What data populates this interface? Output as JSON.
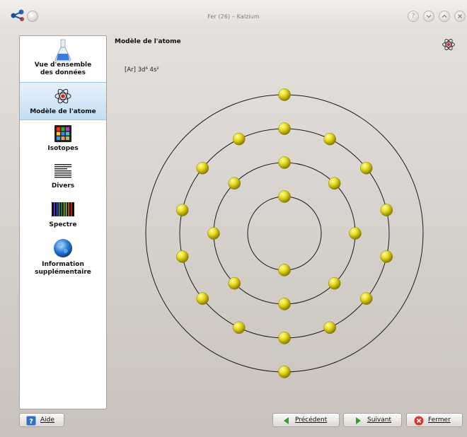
{
  "window": {
    "title": "Fer (26) – Kalzium"
  },
  "sidebar": {
    "items": [
      {
        "label": "Vue d'ensemble des données",
        "line1": "Vue d'ensemble",
        "line2": "des données",
        "icon": "flask-icon"
      },
      {
        "label": "Modèle de l'atome",
        "icon": "atom-icon",
        "selected": true
      },
      {
        "label": "Isotopes",
        "icon": "isotopes-grid-icon"
      },
      {
        "label": "Divers",
        "icon": "misc-lines-icon"
      },
      {
        "label": "Spectre",
        "icon": "spectrum-icon"
      },
      {
        "label": "Information supplémentaire",
        "line1": "Information",
        "line2": "supplémentaire",
        "icon": "globe-icon"
      }
    ]
  },
  "main": {
    "title": "Modèle de l'atome",
    "configuration": "[Ar] 3d⁶ 4s²",
    "atom_model": {
      "element": "Fer",
      "atomic_number": 26,
      "shells": [
        2,
        8,
        14,
        2
      ],
      "electron_color": "#e3db16",
      "orbit_color": "#1a1a1a"
    }
  },
  "buttons": {
    "help": "Aide",
    "previous": "Précédent",
    "next": "Suivant",
    "close": "Fermer"
  },
  "colors": {
    "selection": "#c4ddf4",
    "next_arrow": "#2aa52a",
    "close_icon": "#d53a2b",
    "help_icon": "#2f72c4"
  }
}
